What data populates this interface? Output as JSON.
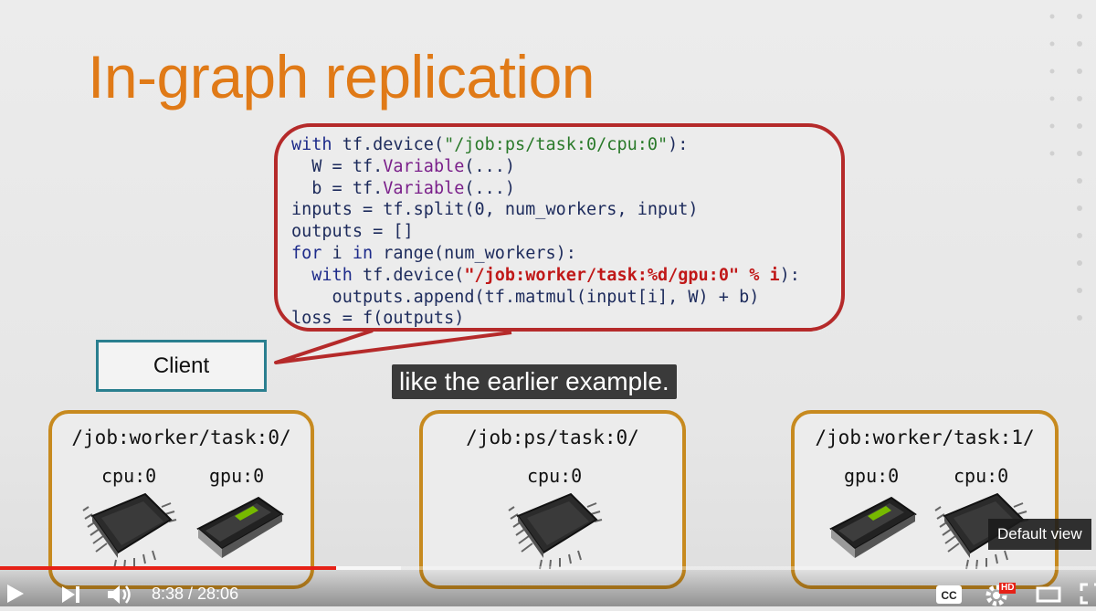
{
  "slide": {
    "title": "In-graph replication",
    "code_lines": [
      [
        {
          "t": "with",
          "c": "kw"
        },
        {
          "t": " tf.device(",
          "c": ""
        },
        {
          "t": "\"/job:ps/task:0/cpu:0\"",
          "c": "str"
        },
        {
          "t": "):",
          "c": ""
        }
      ],
      [
        {
          "t": "  W = tf.",
          "c": ""
        },
        {
          "t": "Variable",
          "c": "var"
        },
        {
          "t": "(...)",
          "c": ""
        }
      ],
      [
        {
          "t": "  b = tf.",
          "c": ""
        },
        {
          "t": "Variable",
          "c": "var"
        },
        {
          "t": "(...)",
          "c": ""
        }
      ],
      [
        {
          "t": "inputs = tf.split(0, num_workers, input)",
          "c": ""
        }
      ],
      [
        {
          "t": "outputs = []",
          "c": ""
        }
      ],
      [
        {
          "t": "for",
          "c": "kw"
        },
        {
          "t": " i ",
          "c": ""
        },
        {
          "t": "in",
          "c": "kw"
        },
        {
          "t": " range(num_workers):",
          "c": ""
        }
      ],
      [
        {
          "t": "  ",
          "c": ""
        },
        {
          "t": "with",
          "c": "kw"
        },
        {
          "t": " tf.device(",
          "c": ""
        },
        {
          "t": "\"/job:worker/task:%d/gpu:0\" % i",
          "c": "red"
        },
        {
          "t": "):",
          "c": ""
        }
      ],
      [
        {
          "t": "    outputs.append(tf.matmul(input[i], W) + b)",
          "c": ""
        }
      ],
      [
        {
          "t": "loss = f(outputs)",
          "c": ""
        }
      ]
    ],
    "client_label": "Client",
    "tasks": [
      {
        "label": "/job:worker/task:0/",
        "devices": [
          "cpu:0",
          "gpu:0"
        ]
      },
      {
        "label": "/job:ps/task:0/",
        "devices": [
          "cpu:0"
        ]
      },
      {
        "label": "/job:worker/task:1/",
        "devices": [
          "gpu:0",
          "cpu:0"
        ]
      }
    ]
  },
  "caption": "like the earlier example.",
  "player": {
    "current_time": "8:38",
    "duration": "28:06",
    "time_display": "8:38 / 28:06",
    "progress_fraction": 0.307,
    "buffer_fraction": 0.366,
    "hd_badge": "HD",
    "tooltip": "Default view",
    "icons": [
      "play-icon",
      "next-icon",
      "volume-icon",
      "cc-icon",
      "settings-icon",
      "theater-icon",
      "fullscreen-icon"
    ]
  },
  "colors": {
    "title": "#e07a17",
    "code_border": "#b52a2a",
    "client_border": "#2a7f8f",
    "task_border": "#c78a1f",
    "progress": "#e62117"
  }
}
